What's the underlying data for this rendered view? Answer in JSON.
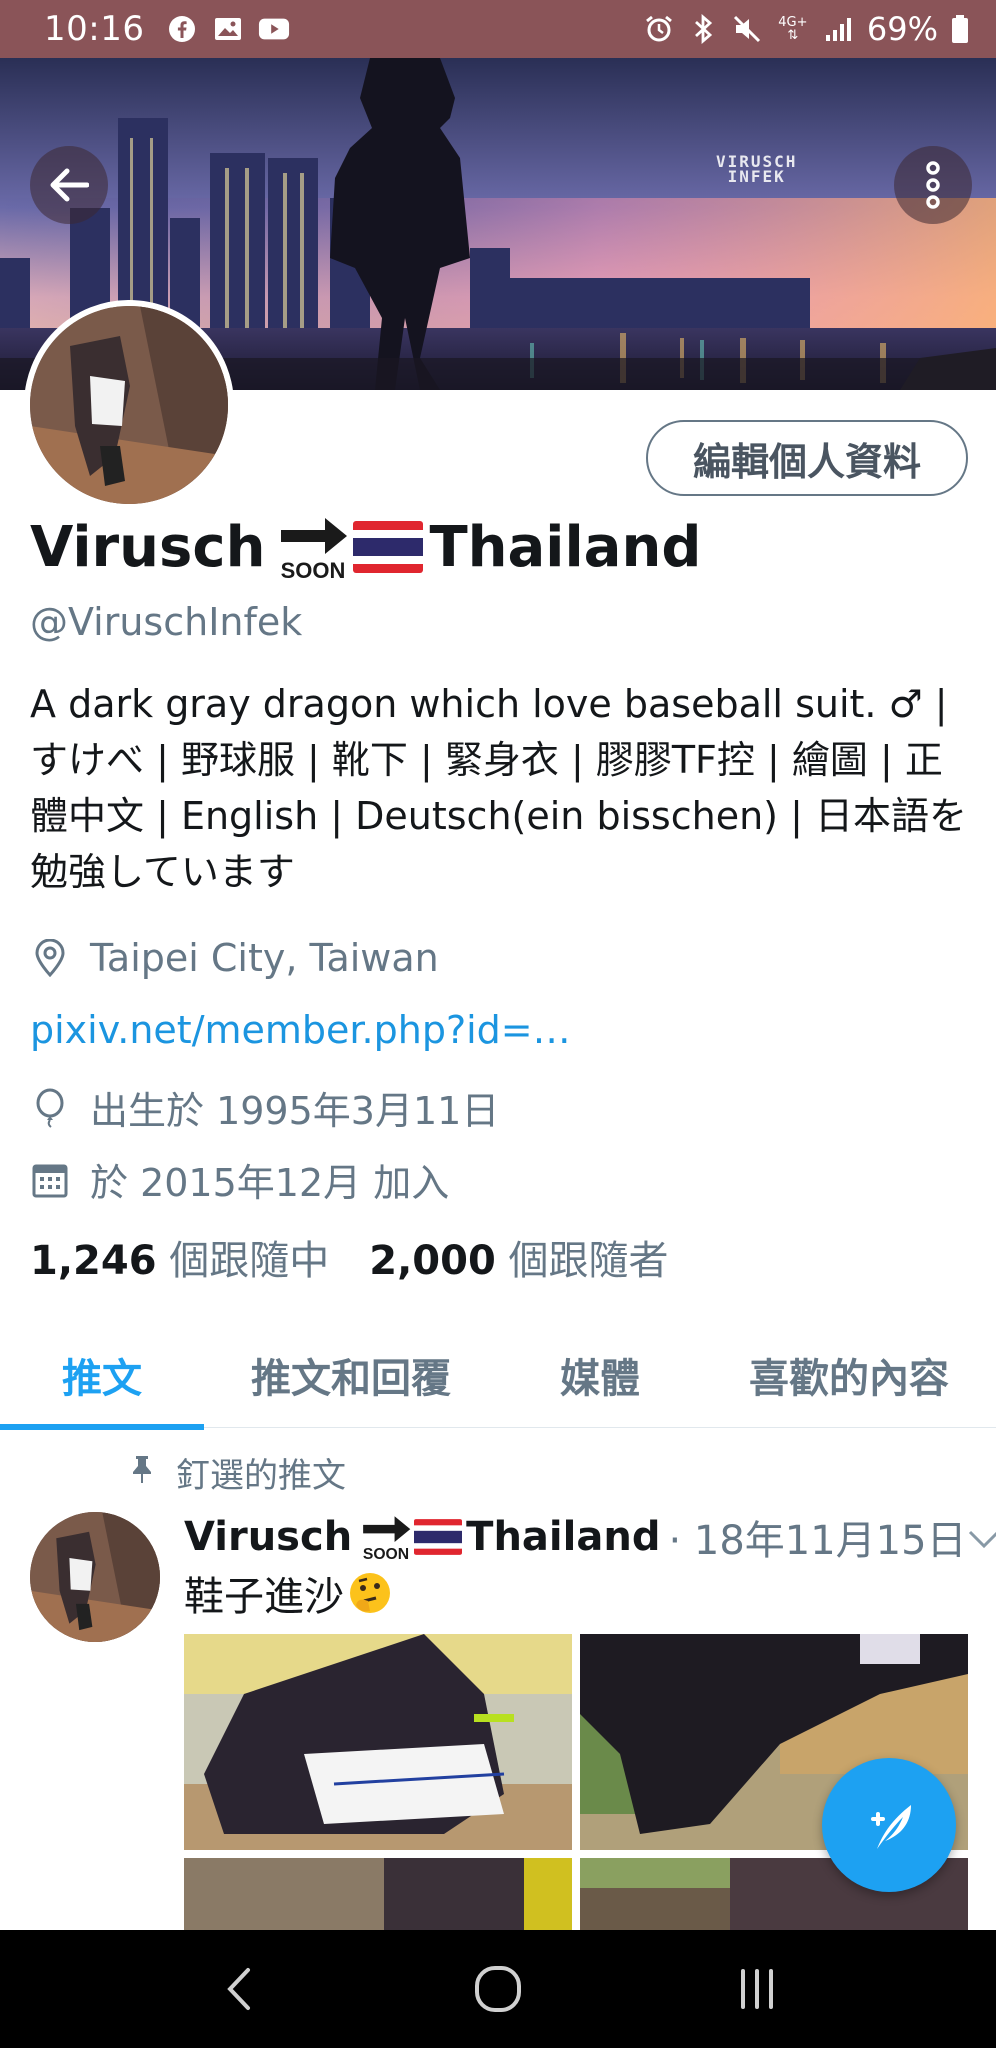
{
  "status_bar": {
    "time": "10:16",
    "battery": "69%",
    "network": "4G+",
    "left_icons": [
      "facebook-icon",
      "gallery-icon",
      "youtube-icon"
    ],
    "right_icons": [
      "alarm-icon",
      "bluetooth-icon",
      "mute-icon",
      "network-icon",
      "signal-icon",
      "battery-icon"
    ]
  },
  "banner": {
    "logo_line1": "VIRUSCH",
    "logo_line2": "INFEK"
  },
  "profile": {
    "edit_button": "編輯個人資料",
    "name_first": "Virusch",
    "soon_label": "SOON",
    "name_last": "Thailand",
    "handle": "@ViruschInfek",
    "bio": "A dark gray dragon which love baseball suit. ♂ | すけべ | 野球服 | 靴下 | 緊身衣 | 膠膠TF控 | 繪圖 | 正體中文 | English | Deutsch(ein bisschen) | 日本語を勉強しています",
    "location": "Taipei City, Taiwan",
    "website": "pixiv.net/member.php?id=…",
    "birthday": "出生於 1995年3月11日",
    "joined": "於 2015年12月 加入",
    "following_count": "1,246",
    "following_label": "個跟隨中",
    "followers_count": "2,000",
    "followers_label": "個跟隨者"
  },
  "tabs": [
    {
      "label": "推文",
      "active": true
    },
    {
      "label": "推文和回覆",
      "active": false
    },
    {
      "label": "媒體",
      "active": false
    },
    {
      "label": "喜歡的內容",
      "active": false
    }
  ],
  "pinned_tweet": {
    "pinned_label": "釘選的推文",
    "name_first": "Virusch",
    "soon_label": "SOON",
    "name_last": "Thailand",
    "date": "· 18年11月15日",
    "text": "鞋子進沙",
    "emoji": "thinking-face-icon"
  },
  "colors": {
    "accent": "#1da1f2",
    "status_bar": "#8a5458",
    "secondary_text": "#657786",
    "link": "#1b95e0"
  }
}
